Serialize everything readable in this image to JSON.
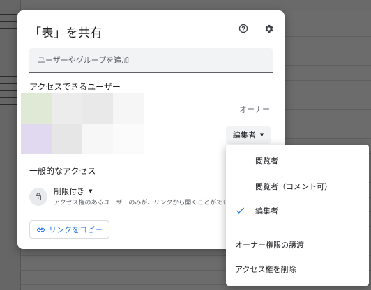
{
  "dialog": {
    "title": "「表」を共有",
    "help_icon": "help-circle-icon",
    "settings_icon": "gear-icon",
    "add_people_placeholder": "ユーザーやグループを追加",
    "people_section_label": "アクセスできるユーザー",
    "owner_role": "オーナー",
    "collaborator_role": "編集者",
    "general_access_label": "一般的なアクセス",
    "access_level": "制限付き",
    "access_description": "アクセス権のあるユーザーのみが、リンクから開くことができます",
    "copy_link_label": "リンクをコピー",
    "link_icon": "link-icon",
    "lock_icon": "lock-icon"
  },
  "role_menu": {
    "items": [
      {
        "label": "閲覧者",
        "selected": false
      },
      {
        "label": "閲覧者（コメント可）",
        "selected": false
      },
      {
        "label": "編集者",
        "selected": true
      }
    ],
    "transfer_label": "オーナー権限の譲渡",
    "remove_label": "アクセス権を削除",
    "check_icon": "check-icon"
  },
  "colors": {
    "accent": "#1a73e8",
    "mosaic": [
      "#dfe9d6",
      "#ececec",
      "#e9e9e9",
      "#f6f6f6",
      "#e0d9f0",
      "#e6e6e6",
      "#f7f7f7",
      "#fbfbfb"
    ]
  }
}
